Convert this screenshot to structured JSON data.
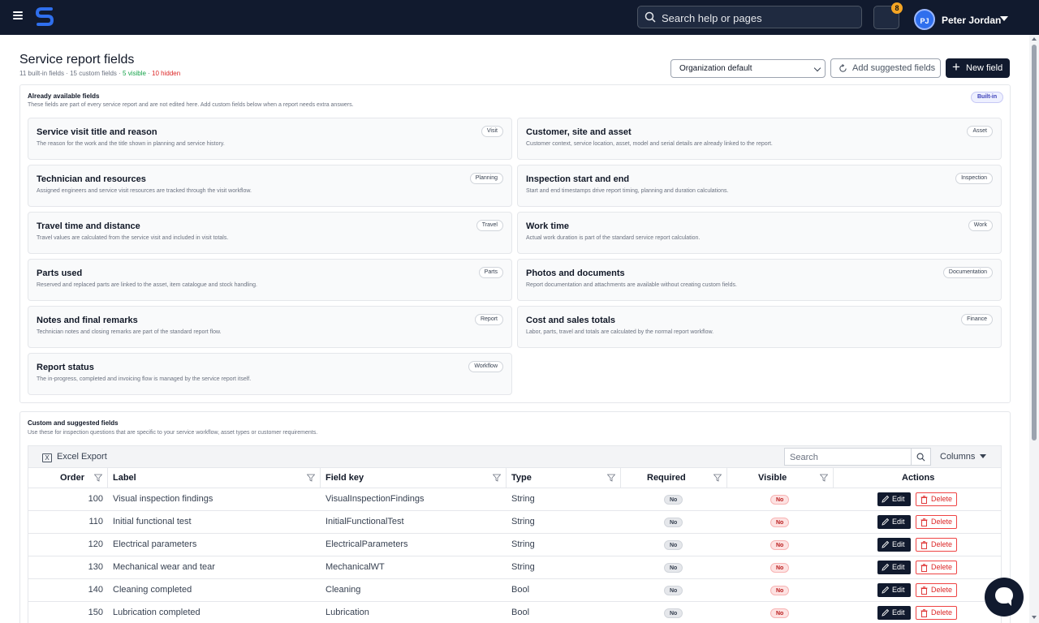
{
  "topbar": {
    "search_placeholder": "Search help or pages",
    "notification_count": "8",
    "user_initials": "PJ",
    "user_name": "Peter Jordan"
  },
  "header": {
    "title": "Service report fields",
    "meta_builtin": "11 built-in fields",
    "meta_sep1": " · ",
    "meta_custom": "15 custom fields",
    "meta_sep2": " · ",
    "meta_visible": "5 visible",
    "meta_sep3": " · ",
    "meta_hidden": "10 hidden",
    "org_select": "Organization default",
    "suggest_label": "Add suggested fields",
    "new_label": "New field"
  },
  "builtin": {
    "title": "Already available fields",
    "subtitle": "These fields are part of every service report and are not edited here. Add custom fields below when a report needs extra answers.",
    "badge": "Built-in",
    "cards": [
      {
        "title": "Service visit title and reason",
        "desc": "The reason for the work and the title shown in planning and service history.",
        "tag": "Visit"
      },
      {
        "title": "Customer, site and asset",
        "desc": "Customer context, service location, asset, model and serial details are already linked to the report.",
        "tag": "Asset"
      },
      {
        "title": "Technician and resources",
        "desc": "Assigned engineers and service visit resources are tracked through the visit workflow.",
        "tag": "Planning"
      },
      {
        "title": "Inspection start and end",
        "desc": "Start and end timestamps drive report timing, planning and duration calculations.",
        "tag": "Inspection"
      },
      {
        "title": "Travel time and distance",
        "desc": "Travel values are calculated from the service visit and included in visit totals.",
        "tag": "Travel"
      },
      {
        "title": "Work time",
        "desc": "Actual work duration is part of the standard service report calculation.",
        "tag": "Work"
      },
      {
        "title": "Parts used",
        "desc": "Reserved and replaced parts are linked to the asset, item catalogue and stock handling.",
        "tag": "Parts"
      },
      {
        "title": "Photos and documents",
        "desc": "Report documentation and attachments are available without creating custom fields.",
        "tag": "Documentation"
      },
      {
        "title": "Notes and final remarks",
        "desc": "Technician notes and closing remarks are part of the standard report flow.",
        "tag": "Report"
      },
      {
        "title": "Cost and sales totals",
        "desc": "Labor, parts, travel and totals are calculated by the normal report workflow.",
        "tag": "Finance"
      },
      {
        "title": "Report status",
        "desc": "The in-progress, completed and invoicing flow is managed by the service report itself.",
        "tag": "Workflow"
      }
    ]
  },
  "custom": {
    "title": "Custom and suggested fields",
    "subtitle": "Use these for inspection questions that are specific to your service workflow, asset types or customer requirements.",
    "excel_label": "Excel Export",
    "search_placeholder": "Search",
    "columns_label": "Columns",
    "headers": {
      "order": "Order",
      "label": "Label",
      "key": "Field key",
      "type": "Type",
      "required": "Required",
      "visible": "Visible",
      "actions": "Actions"
    },
    "edit_label": "Edit",
    "delete_label": "Delete",
    "rows": [
      {
        "order": "100",
        "label": "Visual inspection findings",
        "key": "VisualInspectionFindings",
        "type": "String",
        "required": "No",
        "visible": "No"
      },
      {
        "order": "110",
        "label": "Initial functional test",
        "key": "InitialFunctionalTest",
        "type": "String",
        "required": "No",
        "visible": "No"
      },
      {
        "order": "120",
        "label": "Electrical parameters",
        "key": "ElectricalParameters",
        "type": "String",
        "required": "No",
        "visible": "No"
      },
      {
        "order": "130",
        "label": "Mechanical wear and tear",
        "key": "MechanicalWT",
        "type": "String",
        "required": "No",
        "visible": "No"
      },
      {
        "order": "140",
        "label": "Cleaning completed",
        "key": "Cleaning",
        "type": "Bool",
        "required": "No",
        "visible": "No"
      },
      {
        "order": "150",
        "label": "Lubrication completed",
        "key": "Lubrication",
        "type": "Bool",
        "required": "No",
        "visible": "No"
      }
    ]
  }
}
